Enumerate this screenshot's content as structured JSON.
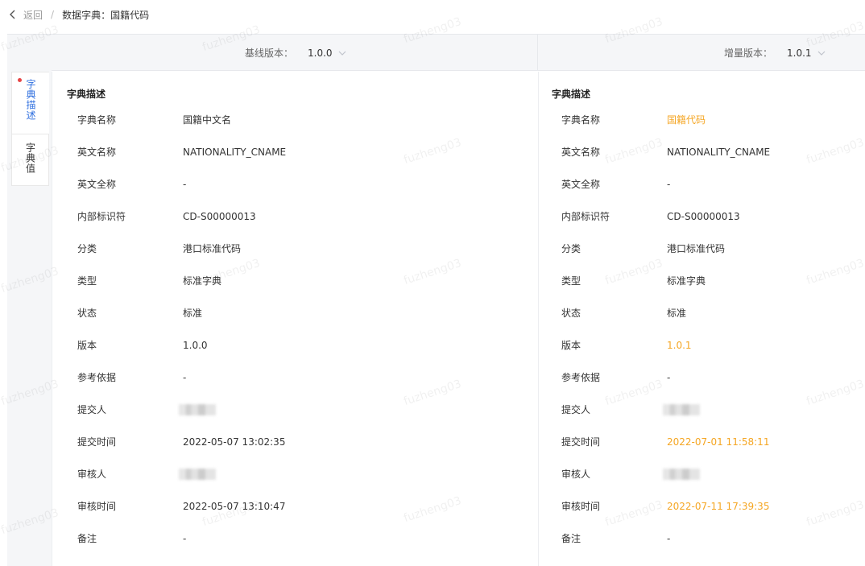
{
  "topbar": {
    "back_label": "返回",
    "separator": "/",
    "title": "数据字典：国籍代码"
  },
  "side_tabs": [
    {
      "label": "字典描述",
      "active": true
    },
    {
      "label": "字典值",
      "active": false
    }
  ],
  "left": {
    "version_label": "基线版本：",
    "version_value": "1.0.0",
    "section_title": "字典描述",
    "rows": [
      {
        "key": "字典名称",
        "value": "国籍中文名"
      },
      {
        "key": "英文名称",
        "value": "NATIONALITY_CNAME"
      },
      {
        "key": "英文全称",
        "value": "-"
      },
      {
        "key": "内部标识符",
        "value": "CD-S00000013"
      },
      {
        "key": "分类",
        "value": "港口标准代码"
      },
      {
        "key": "类型",
        "value": "标准字典"
      },
      {
        "key": "状态",
        "value": "标准"
      },
      {
        "key": "版本",
        "value": "1.0.0"
      },
      {
        "key": "参考依据",
        "value": "-"
      },
      {
        "key": "提交人",
        "value": ""
      },
      {
        "key": "提交时间",
        "value": "2022-05-07 13:02:35"
      },
      {
        "key": "审核人",
        "value": ""
      },
      {
        "key": "审核时间",
        "value": "2022-05-07 13:10:47"
      },
      {
        "key": "备注",
        "value": "-"
      }
    ]
  },
  "right": {
    "version_label": "增量版本：",
    "version_value": "1.0.1",
    "section_title": "字典描述",
    "rows": [
      {
        "key": "字典名称",
        "value": "国籍代码"
      },
      {
        "key": "英文名称",
        "value": "NATIONALITY_CNAME"
      },
      {
        "key": "英文全称",
        "value": "-"
      },
      {
        "key": "内部标识符",
        "value": "CD-S00000013"
      },
      {
        "key": "分类",
        "value": "港口标准代码"
      },
      {
        "key": "类型",
        "value": "标准字典"
      },
      {
        "key": "状态",
        "value": "标准"
      },
      {
        "key": "版本",
        "value": "1.0.1"
      },
      {
        "key": "参考依据",
        "value": "-"
      },
      {
        "key": "提交人",
        "value": ""
      },
      {
        "key": "提交时间",
        "value": "2022-07-01 11:58:11"
      },
      {
        "key": "审核人",
        "value": ""
      },
      {
        "key": "审核时间",
        "value": "2022-07-11 17:39:35"
      },
      {
        "key": "备注",
        "value": "-"
      }
    ]
  },
  "watermark": "fuzheng03",
  "colors": {
    "accent": "#2f6fdf",
    "changed": "#f5a623",
    "dot": "#e64545"
  }
}
